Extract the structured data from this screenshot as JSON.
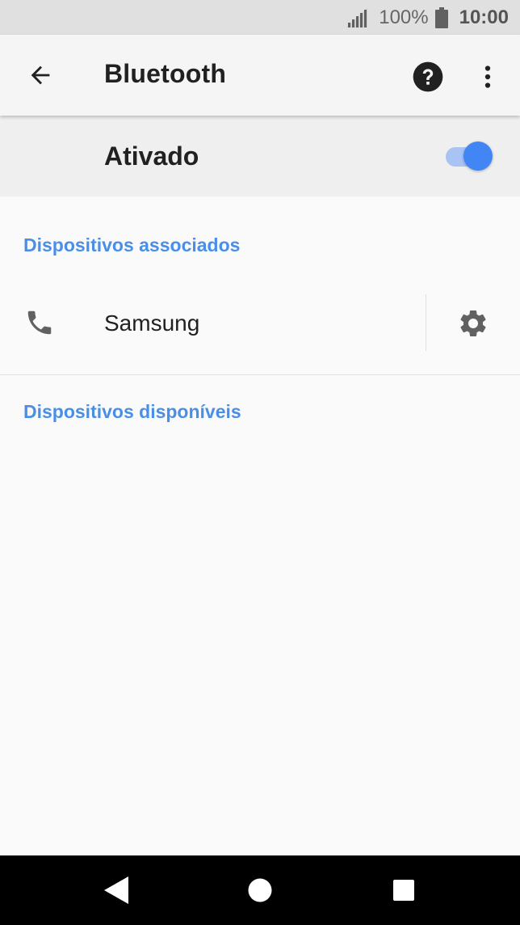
{
  "status_bar": {
    "signal_icon": "cell-signal-icon",
    "battery_percent": "100%",
    "battery_icon": "battery-full-icon",
    "time": "10:00"
  },
  "app_bar": {
    "back_icon": "arrow-back-icon",
    "title": "Bluetooth",
    "help_icon": "help-circle-icon",
    "menu_icon": "more-vert-icon"
  },
  "master_switch": {
    "label": "Ativado",
    "state": "on",
    "accent_color": "#4285f4"
  },
  "sections": {
    "paired_header": "Dispositivos associados",
    "available_header": "Dispositivos disponíveis"
  },
  "paired_devices": [
    {
      "name": "Samsung",
      "type_icon": "phone-icon",
      "settings_icon": "gear-icon"
    }
  ],
  "nav_bar": {
    "back_icon": "nav-back-icon",
    "home_icon": "nav-home-icon",
    "recents_icon": "nav-recents-icon"
  },
  "colors": {
    "section_header": "#4a8fe7",
    "status_bar_bg": "#e0e0e0",
    "nav_bar_bg": "#000000"
  }
}
